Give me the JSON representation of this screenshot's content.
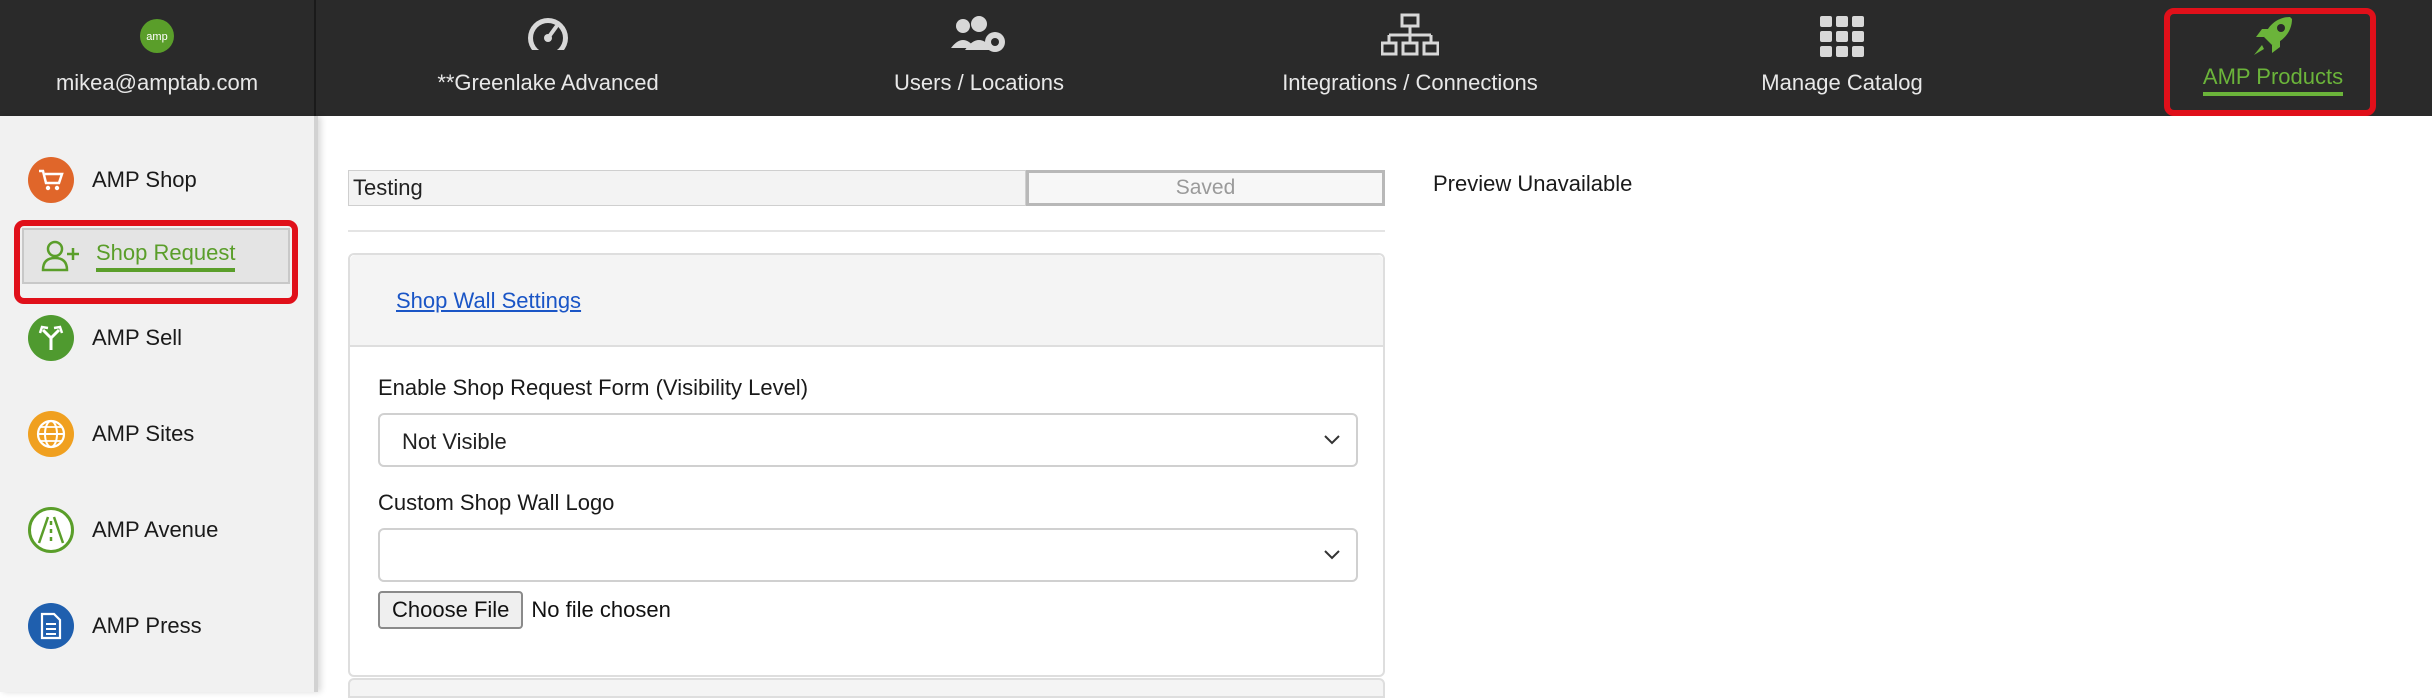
{
  "topnav": {
    "account_email": "mikea@amptab.com",
    "items": [
      {
        "label": "**Greenlake Advanced",
        "icon": "dashboard-gauge-icon"
      },
      {
        "label": "Users / Locations",
        "icon": "users-gear-icon"
      },
      {
        "label": "Integrations / Connections",
        "icon": "network-icon"
      },
      {
        "label": "Manage Catalog",
        "icon": "grid-icon"
      },
      {
        "label": "AMP Products",
        "icon": "rocket-icon",
        "active": true
      }
    ]
  },
  "sidebar": {
    "items": [
      {
        "label": "AMP Shop",
        "icon": "cart-icon",
        "color": "#e0662a"
      },
      {
        "label": "Shop Request",
        "icon": "user-plus-icon",
        "color": "#5a9e2a",
        "active": true
      },
      {
        "label": "AMP Sell",
        "icon": "branch-arrows-icon",
        "color": "#4f9a2f"
      },
      {
        "label": "AMP Sites",
        "icon": "globe-icon",
        "color": "#f0a020"
      },
      {
        "label": "AMP Avenue",
        "icon": "road-icon",
        "color": "#5a9e2a"
      },
      {
        "label": "AMP Press",
        "icon": "document-icon",
        "color": "#1f5fae"
      }
    ]
  },
  "form": {
    "name_value": "Testing",
    "saved_label": "Saved",
    "section_link": "Shop Wall Settings",
    "visibility_label": "Enable Shop Request Form (Visibility Level)",
    "visibility_value": "Not Visible",
    "logo_label": "Custom Shop Wall Logo",
    "logo_value": "",
    "choose_file_label": "Choose File",
    "no_file_text": "No file chosen"
  },
  "preview": {
    "text": "Preview Unavailable"
  },
  "colors": {
    "topbar": "#2a2a2a",
    "accent_green": "#5a9e2a",
    "highlight_red": "#e0101a",
    "link_blue": "#1a55c6"
  }
}
